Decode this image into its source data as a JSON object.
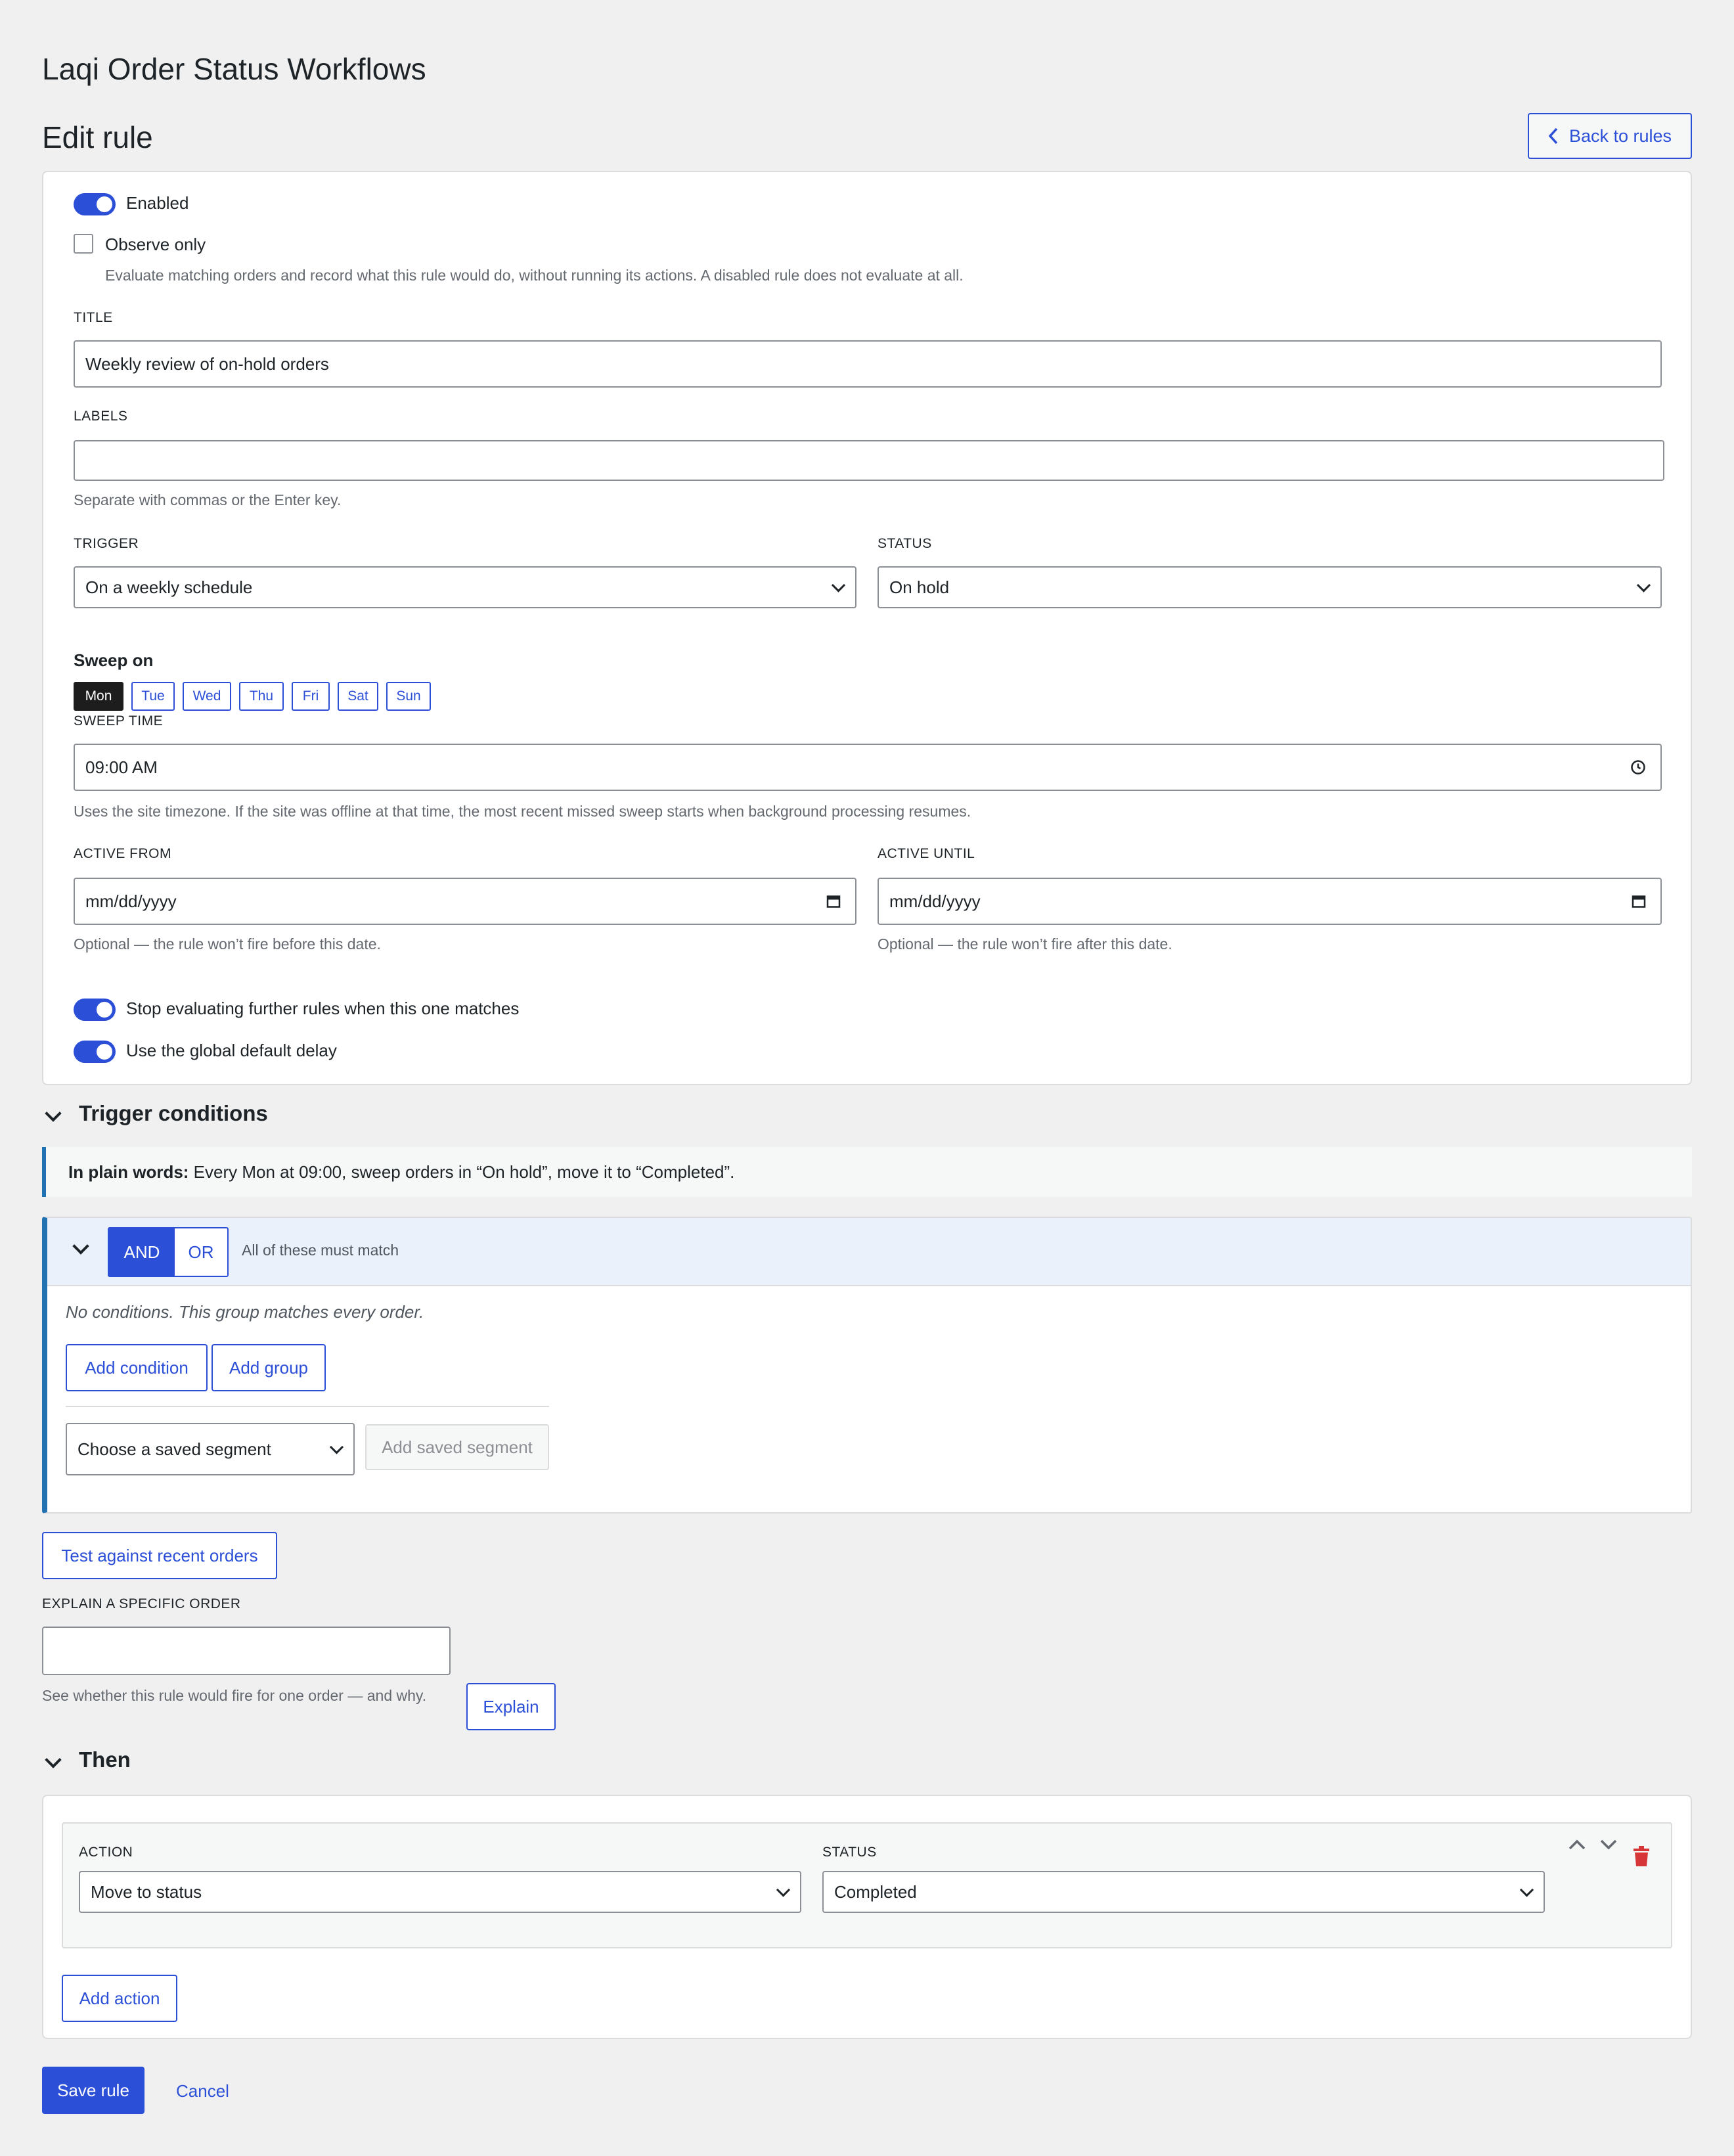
{
  "app_title": "Laqi Order Status Workflows",
  "page_title": "Edit rule",
  "back_button": "Back to rules",
  "settings": {
    "enabled_label": "Enabled",
    "enabled": true,
    "observe_only_label": "Observe only",
    "observe_only": false,
    "observe_only_help": "Evaluate matching orders and record what this rule would do, without running its actions. A disabled rule does not evaluate at all.",
    "title_label": "TITLE",
    "title_value": "Weekly review of on-hold orders",
    "labels_label": "LABELS",
    "labels_value": "",
    "labels_help": "Separate with commas or the Enter key.",
    "trigger_label": "TRIGGER",
    "trigger_value": "On a weekly schedule",
    "status_label": "STATUS",
    "status_value": "On hold",
    "sweep_on_label": "Sweep on",
    "days": [
      "Mon",
      "Tue",
      "Wed",
      "Thu",
      "Fri",
      "Sat",
      "Sun"
    ],
    "active_day": "Mon",
    "sweep_time_label": "SWEEP TIME",
    "sweep_time_value": "09:00 AM",
    "sweep_time_help": "Uses the site timezone. If the site was offline at that time, the most recent missed sweep starts when background processing resumes.",
    "active_from_label": "ACTIVE FROM",
    "active_from_placeholder": "mm/dd/yyyy",
    "active_from_help": "Optional — the rule won’t fire before this date.",
    "active_until_label": "ACTIVE UNTIL",
    "active_until_placeholder": "mm/dd/yyyy",
    "active_until_help": "Optional — the rule won’t fire after this date.",
    "stop_further_label": "Stop evaluating further rules when this one matches",
    "stop_further": true,
    "global_delay_label": "Use the global default delay",
    "global_delay": true
  },
  "conditions": {
    "section_title": "Trigger conditions",
    "plain_words_prefix": "In plain words:",
    "plain_words_text": " Every Mon at 09:00, sweep orders in “On hold”, move it to “Completed”.",
    "and_label": "AND",
    "or_label": "OR",
    "group_mode": "AND",
    "group_hint": "All of these must match",
    "empty_text": "No conditions. This group matches every order.",
    "add_condition": "Add condition",
    "add_group": "Add group",
    "segment_placeholder": "Choose a saved segment",
    "add_saved_segment": "Add saved segment"
  },
  "testing": {
    "test_button": "Test against recent orders",
    "explain_label": "EXPLAIN A SPECIFIC ORDER",
    "explain_value": "",
    "explain_help": "See whether this rule would fire for one order — and why.",
    "explain_button": "Explain"
  },
  "then": {
    "section_title": "Then",
    "action_label": "ACTION",
    "action_value": "Move to status",
    "status_label": "STATUS",
    "status_value": "Completed",
    "add_action": "Add action"
  },
  "footer": {
    "save": "Save rule",
    "cancel": "Cancel"
  },
  "colors": {
    "accent": "#2c4fd8",
    "delete": "#d63638",
    "background": "#f0f0f1"
  }
}
